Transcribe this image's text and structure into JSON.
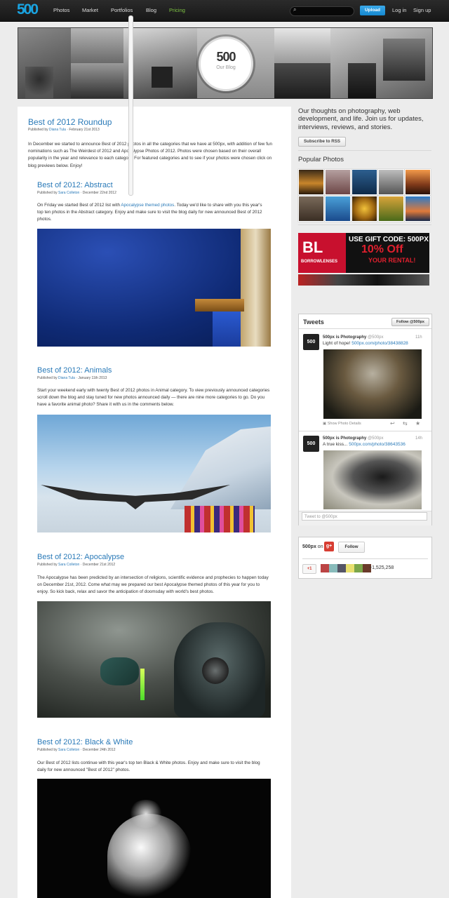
{
  "nav": {
    "logo": "500",
    "items": [
      "Photos",
      "Market",
      "Portfolios",
      "Blog",
      "Pricing"
    ],
    "upload": "Upload",
    "login": "Log in",
    "signup": "Sign up"
  },
  "banner": {
    "badge_mark": "500",
    "badge_sub": "Our Blog"
  },
  "posts": {
    "roundup": {
      "title": "Best of 2012 Roundup",
      "meta_prefix": "Published by ",
      "author": "Diana Tula",
      "meta_suffix": " · February 21st 2013",
      "body": "In December we started to announce Best of 2012 photos in all the categories that we have at 500px, with addition of few fun nominations such as The Weirdest of 2012 and Apocalypse Photos of 2012. Photos were chosen based on their overall popularity in the year and relevance to each category. For featured categories and to see if your photos were chosen click on blog previews below. Enjoy!"
    },
    "abstract": {
      "title": "Best of 2012: Abstract",
      "meta_prefix": "Published by ",
      "author": "Sara Colleton",
      "meta_suffix": " · December 22nd 2012",
      "body_a": "On Friday we started Best of 2012 list with ",
      "body_link": "Apocalypse themed photos",
      "body_b": ". Today we'd like to share with you this year's top ten photos in the Abstract category. Enjoy and make sure to visit the blog daily for new announced Best of 2012 photos."
    },
    "animals": {
      "title": "Best of 2012: Animals",
      "meta_prefix": "Published by ",
      "author": "Diana Tula",
      "meta_suffix": " · January 11th 2013",
      "body": "Start your weekend early with twenty Best of 2012 photos in Animal category. To view previously announced categories scroll down the blog and stay tuned for new photos announced daily — there are nine more categories to go. Do you have a favorite animal photo? Share it with us in the comments below."
    },
    "apocalypse": {
      "title": "Best of 2012: Apocalypse",
      "meta_prefix": "Published by ",
      "author": "Sara Colleton",
      "meta_suffix": " · December 21st 2012",
      "body": "The Apocalypse has been predicted by an intersection of religions, scientific evidence and prophecies to happen today on December 21st, 2012. Come what may we prepared our best Apocalypse themed photos of this year for you to enjoy. So kick back, relax and savor the anticipation of doomsday with world's best photos."
    },
    "bw": {
      "title": "Best of 2012: Black & White",
      "meta_prefix": "Published by ",
      "author": "Sara Colleton",
      "meta_suffix": " · December 24th 2012",
      "body": "Our Best of 2012 lists continue with this year's top ten Black & White photos. Enjoy and make sure to visit the blog daily for new announced \"Best of 2012\" photos."
    }
  },
  "sidebar": {
    "intro": "Our thoughts on photography, web development, and life. Join us for updates, interviews, reviews, and stories.",
    "rss": "Subscribe to RSS",
    "popular_title": "Popular Photos",
    "ad_code_line1": "USE GIFT CODE: 500PX",
    "ad_code_line2": "10% Off",
    "ad_code_line3": "YOUR RENTAL!",
    "ad_brand": "BL",
    "ad_brand_sub": "BORROWLENSES",
    "tweets": {
      "title": "Tweets",
      "follow": "Follow @500px",
      "items": [
        {
          "name": "500px is Photography",
          "handle": "@500px",
          "time": "11h",
          "text": "Light of hope! ",
          "link": "500px.com/photo/38438828",
          "details": "Show Photo Details"
        },
        {
          "name": "500px is Photography",
          "handle": "@500px",
          "time": "14h",
          "text": "A true kiss... ",
          "link": "500px.com/photo/38643536"
        }
      ],
      "compose_placeholder": "Tweet to @500px"
    },
    "gplus": {
      "name": "500px",
      "on": " on",
      "follow": "Follow",
      "plusone": "+1",
      "count": "+1,525,258"
    }
  },
  "colors": {
    "accent": "#2a7ab8",
    "upload": "#1a8fd6",
    "pricing": "#7dc242",
    "nav_bg": "#1e1e1e"
  }
}
